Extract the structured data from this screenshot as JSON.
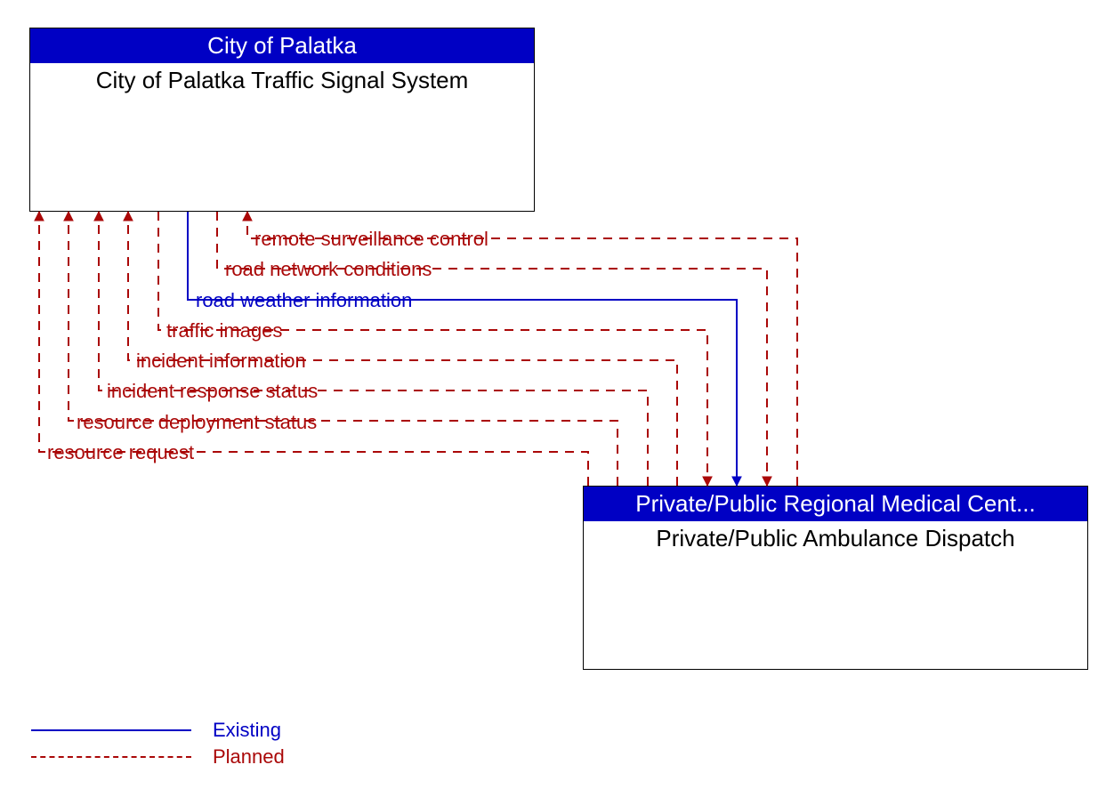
{
  "boxes": {
    "top": {
      "header": "City of Palatka",
      "body": "City of Palatka Traffic Signal System"
    },
    "bottom": {
      "header": "Private/Public Regional Medical Cent...",
      "body": "Private/Public Ambulance Dispatch"
    }
  },
  "flows": [
    {
      "label": "remote surveillance control",
      "status": "planned",
      "direction": "to_top"
    },
    {
      "label": "road network conditions",
      "status": "planned",
      "direction": "to_bottom"
    },
    {
      "label": "road weather information",
      "status": "existing",
      "direction": "to_bottom"
    },
    {
      "label": "traffic images",
      "status": "planned",
      "direction": "to_bottom"
    },
    {
      "label": "incident information",
      "status": "planned",
      "direction": "to_top"
    },
    {
      "label": "incident response status",
      "status": "planned",
      "direction": "to_top"
    },
    {
      "label": "resource deployment status",
      "status": "planned",
      "direction": "to_top"
    },
    {
      "label": "resource request",
      "status": "planned",
      "direction": "to_top"
    }
  ],
  "legend": {
    "existing": "Existing",
    "planned": "Planned"
  },
  "colors": {
    "existing": "#0000c4",
    "planned": "#aa0808",
    "header_bg": "#0000c4"
  }
}
